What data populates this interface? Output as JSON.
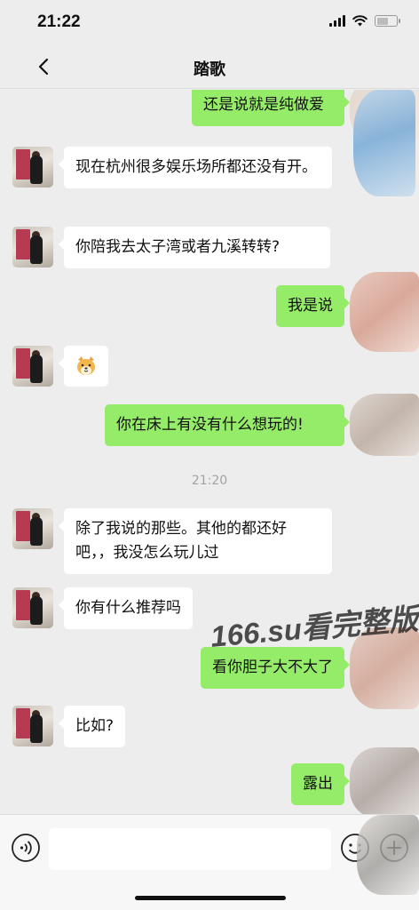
{
  "status_bar": {
    "time": "21:22"
  },
  "nav": {
    "title": "踏歌"
  },
  "messages": [
    {
      "side": "out",
      "text": "还是说就是纯做爱"
    },
    {
      "side": "in",
      "text": "现在杭州很多娱乐场所都还没有开。"
    },
    {
      "side": "in",
      "text": "你陪我去太子湾或者九溪转转?"
    },
    {
      "side": "out",
      "text": "我是说"
    },
    {
      "side": "in",
      "emoji": "dog-face-emoji"
    },
    {
      "side": "out",
      "text": "你在床上有没有什么想玩的!"
    },
    {
      "timestamp": "21:20"
    },
    {
      "side": "in",
      "text": "除了我说的那些。其他的都还好吧，，我没怎么玩儿过"
    },
    {
      "side": "in",
      "text": "你有什么推荐吗"
    },
    {
      "side": "out",
      "text": "看你胆子大不大了"
    },
    {
      "side": "in",
      "text": "比如?"
    },
    {
      "side": "out",
      "text": "露出"
    }
  ],
  "watermark": "166.su看完整版",
  "input_bar": {
    "placeholder": ""
  },
  "colors": {
    "background": "#ededed",
    "outgoing_bubble": "#95ec69",
    "incoming_bubble": "#ffffff",
    "timestamp": "#a3a3a3"
  },
  "icons": [
    "back-icon",
    "voice-icon",
    "emoji-icon",
    "plus-icon",
    "signal-icon",
    "wifi-icon",
    "battery-icon"
  ]
}
